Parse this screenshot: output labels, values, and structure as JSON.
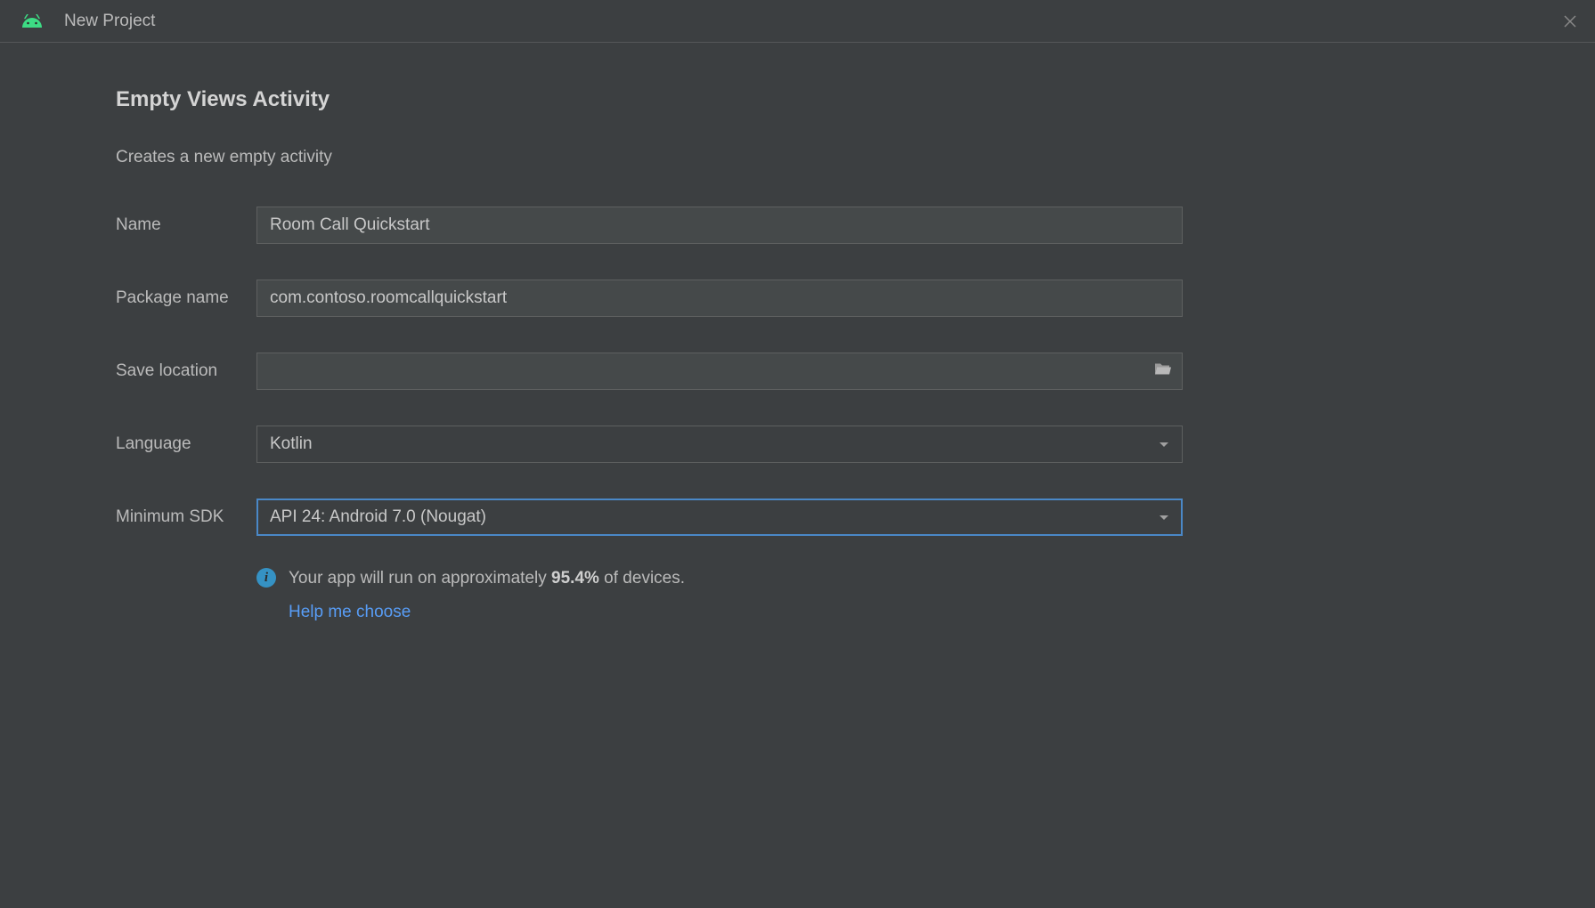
{
  "titlebar": {
    "title": "New Project"
  },
  "page": {
    "heading": "Empty Views Activity",
    "description": "Creates a new empty activity"
  },
  "form": {
    "name": {
      "label": "Name",
      "value": "Room Call Quickstart"
    },
    "package": {
      "label": "Package name",
      "value": "com.contoso.roomcallquickstart"
    },
    "save_location": {
      "label": "Save location",
      "value": ""
    },
    "language": {
      "label": "Language",
      "value": "Kotlin"
    },
    "min_sdk": {
      "label": "Minimum SDK",
      "value": "API 24: Android 7.0 (Nougat)"
    }
  },
  "info": {
    "text_before": "Your app will run on approximately ",
    "percent": "95.4%",
    "text_after": " of devices.",
    "help_link": "Help me choose"
  }
}
